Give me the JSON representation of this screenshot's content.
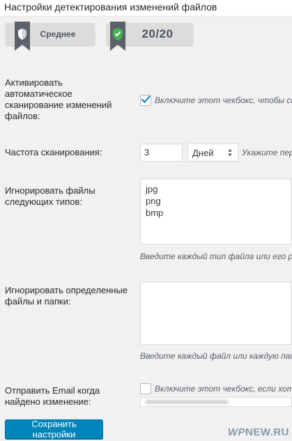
{
  "panel": {
    "title": "Настройки детектирования изменений файлов"
  },
  "badges": {
    "level_label": "Среднее",
    "score_label": "20/20"
  },
  "fields": {
    "auto_scan": {
      "label": "Активировать автоматическое сканирование изменений файлов:",
      "checked": true,
      "hint": "Включите этот чекбокс, чтобы сис"
    },
    "scan_frequency": {
      "label": "Частота сканирования:",
      "value": "3",
      "unit_selected": "Дней",
      "hint": "Укажите пер"
    },
    "ignore_types": {
      "label": "Игнорировать файлы следующих типов:",
      "lines": [
        "jpg",
        "png",
        "bmp"
      ],
      "hint": "Введите каждый тип файла или его рас"
    },
    "ignore_paths": {
      "label": "Игнорировать определенные файлы и папки:",
      "lines": [],
      "hint": "Введите каждый файл или каждую папк"
    },
    "email_notify": {
      "label": "Отправить Email когда найдено изменение:",
      "checked": false,
      "hint": "Включите этот чекбокс, если хоти"
    }
  },
  "actions": {
    "save_label": "Сохранить настройки"
  },
  "watermark": {
    "left": "WP",
    "right": "NEW.RU"
  },
  "colors": {
    "primary_button": "#0085ba",
    "check_blue": "#1e8cbe",
    "badge_gray": "#dcdcdc",
    "shield_green": "#46b450"
  },
  "icons": {
    "level_badge": "shield-icon",
    "score_badge": "shield-check-icon",
    "select_arrow": "chevron-updown-icon",
    "checkmark": "checkmark-icon"
  }
}
